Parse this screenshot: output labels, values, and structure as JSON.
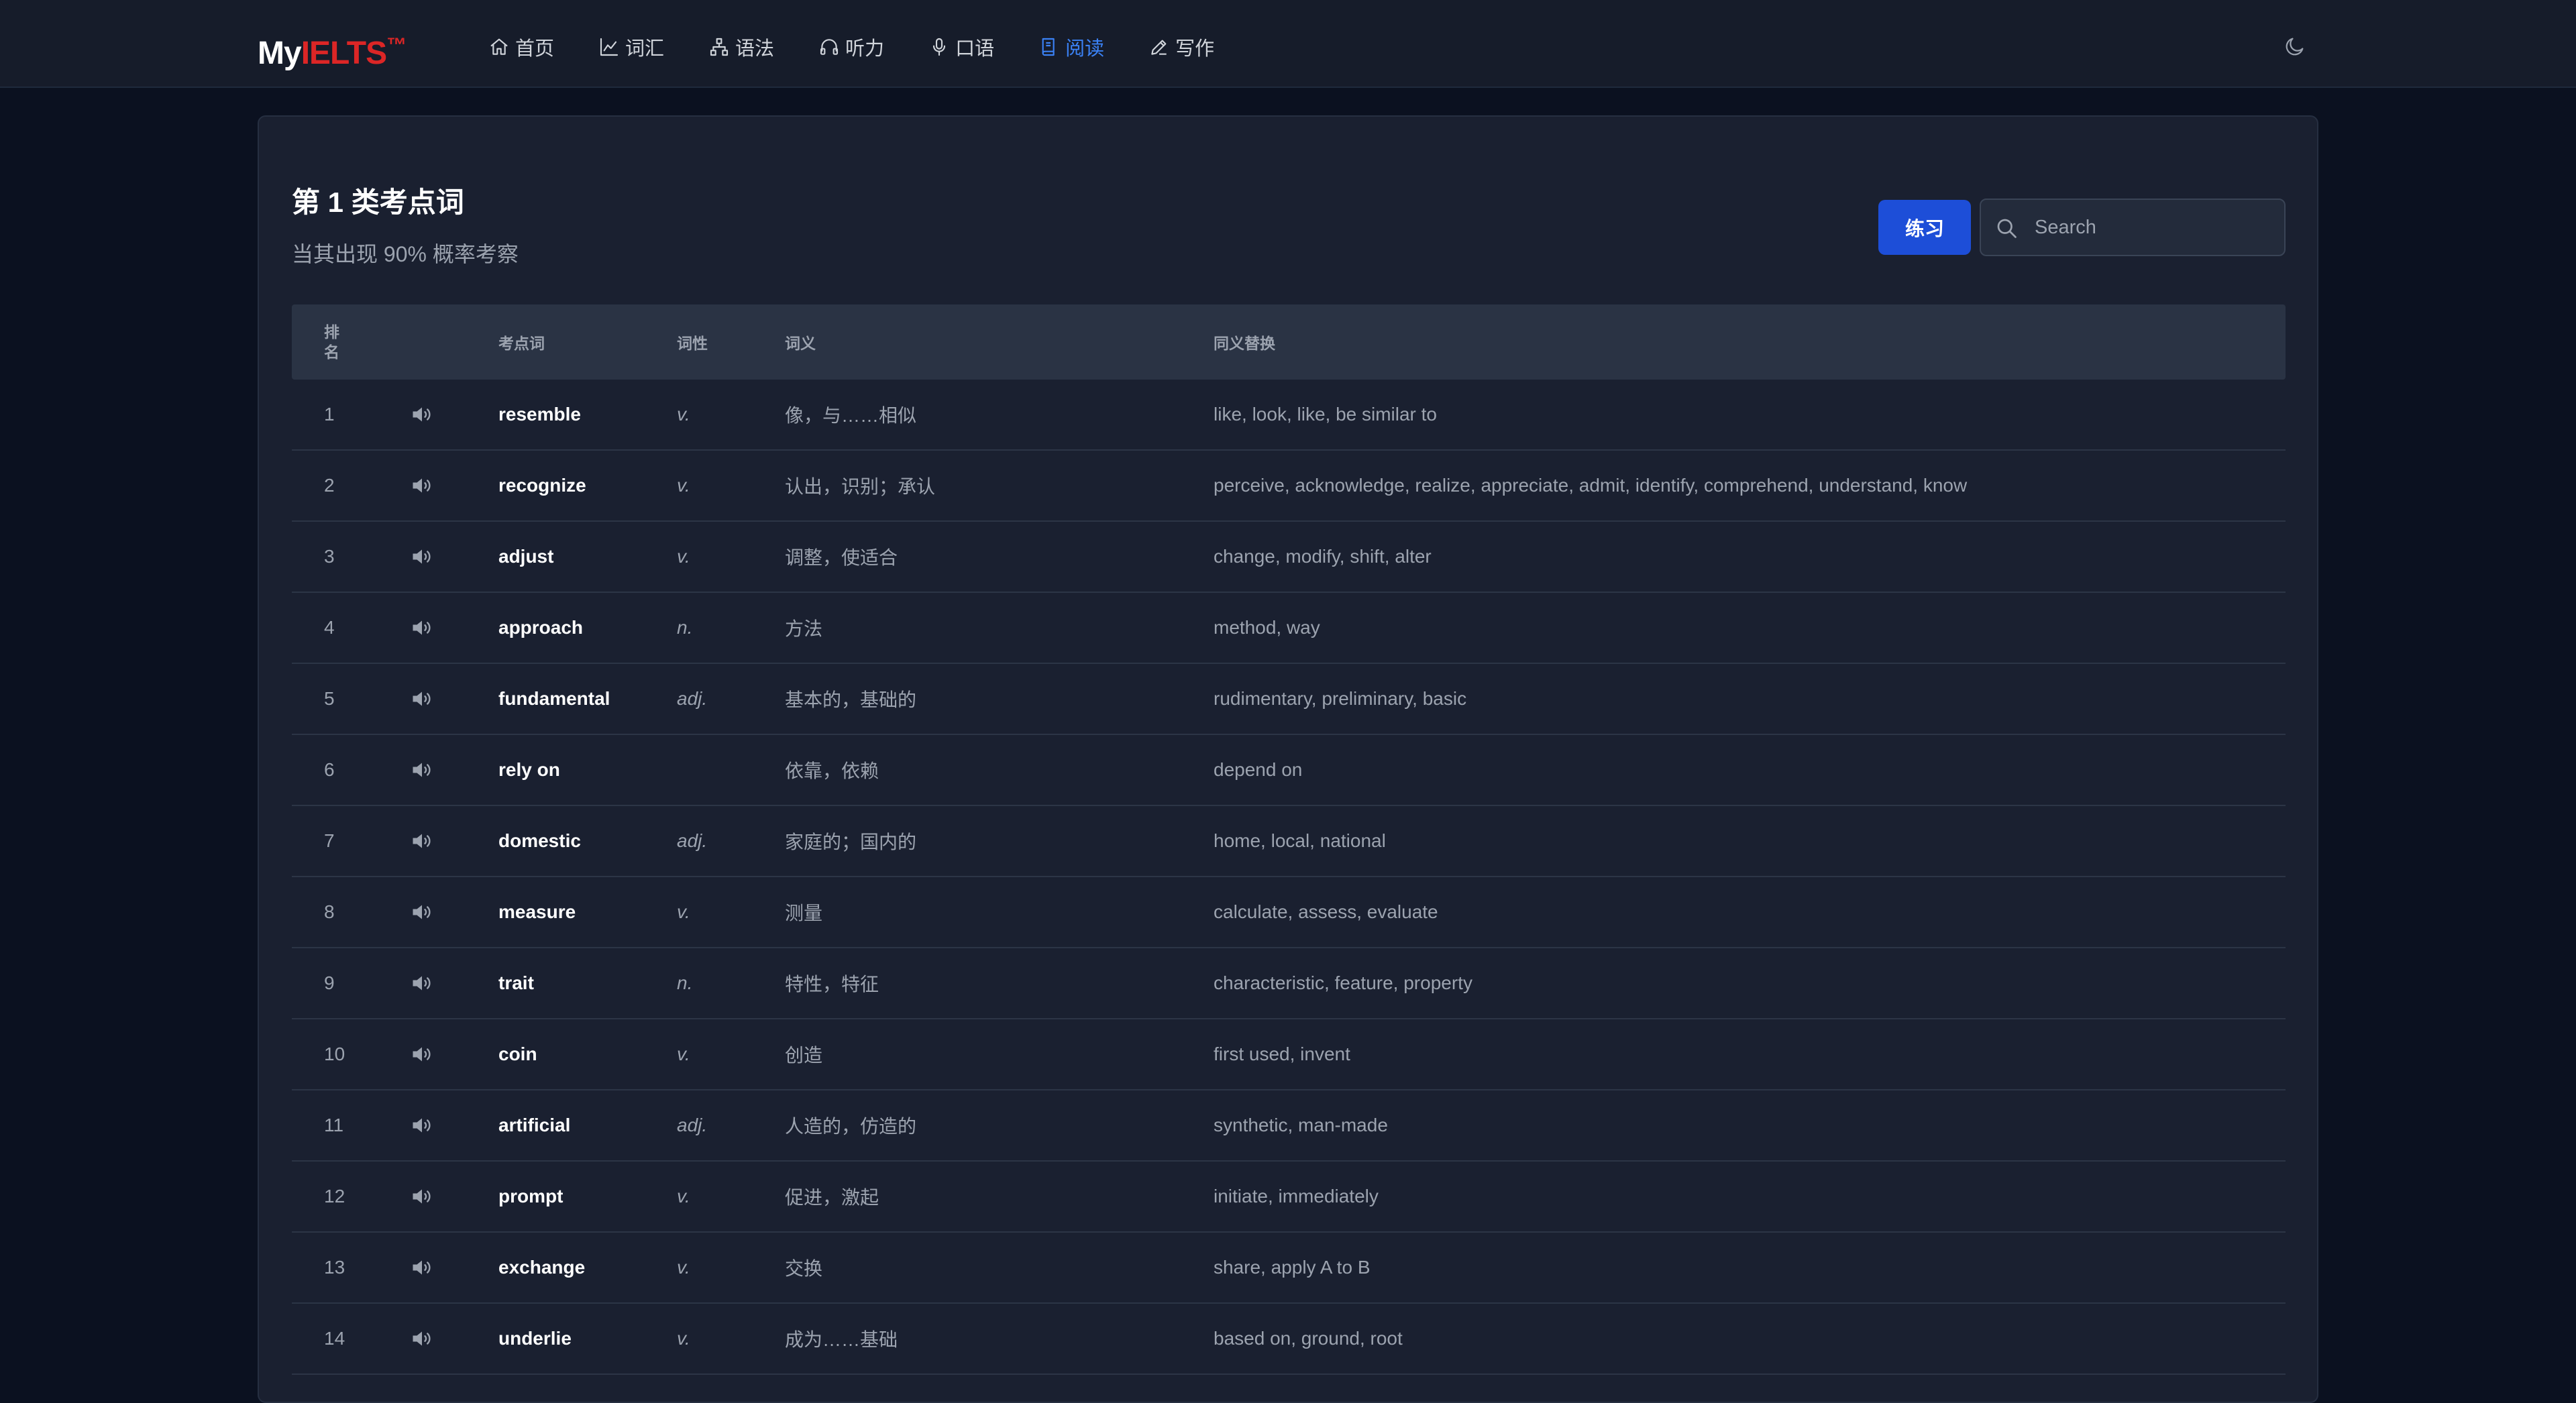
{
  "nav": {
    "logo_prefix": "My",
    "logo_brand": "IELTS",
    "logo_tm": "™",
    "items": [
      {
        "label": "首页",
        "icon": "home-icon",
        "active": false
      },
      {
        "label": "词汇",
        "icon": "chart-icon",
        "active": false
      },
      {
        "label": "语法",
        "icon": "sitemap-icon",
        "active": false
      },
      {
        "label": "听力",
        "icon": "headphones-icon",
        "active": false
      },
      {
        "label": "口语",
        "icon": "microphone-icon",
        "active": false
      },
      {
        "label": "阅读",
        "icon": "book-icon",
        "active": true
      },
      {
        "label": "写作",
        "icon": "pencil-icon",
        "active": false
      }
    ],
    "theme_icon": "moon-icon"
  },
  "card": {
    "title": "第 1 类考点词",
    "subtitle": "当其出现 90% 概率考察",
    "practice_label": "练习",
    "search_placeholder": "Search"
  },
  "table": {
    "headers": {
      "rank": "排名",
      "word": "考点词",
      "pos": "词性",
      "meaning": "词义",
      "synonyms": "同义替换"
    },
    "rows": [
      {
        "rank": "1",
        "word": "resemble",
        "pos": "v.",
        "meaning": "像，与……相似",
        "synonyms": "like, look, like, be similar to"
      },
      {
        "rank": "2",
        "word": "recognize",
        "pos": "v.",
        "meaning": "认出，识别；承认",
        "synonyms": "perceive, acknowledge, realize, appreciate, admit, identify, comprehend, understand, know"
      },
      {
        "rank": "3",
        "word": "adjust",
        "pos": "v.",
        "meaning": "调整，使适合",
        "synonyms": "change, modify, shift, alter"
      },
      {
        "rank": "4",
        "word": "approach",
        "pos": "n.",
        "meaning": "方法",
        "synonyms": "method, way"
      },
      {
        "rank": "5",
        "word": "fundamental",
        "pos": "adj.",
        "meaning": "基本的，基础的",
        "synonyms": "rudimentary, preliminary, basic"
      },
      {
        "rank": "6",
        "word": "rely on",
        "pos": "",
        "meaning": "依靠，依赖",
        "synonyms": "depend on"
      },
      {
        "rank": "7",
        "word": "domestic",
        "pos": "adj.",
        "meaning": "家庭的；国内的",
        "synonyms": "home, local, national"
      },
      {
        "rank": "8",
        "word": "measure",
        "pos": "v.",
        "meaning": "测量",
        "synonyms": "calculate, assess, evaluate"
      },
      {
        "rank": "9",
        "word": "trait",
        "pos": "n.",
        "meaning": "特性，特征",
        "synonyms": "characteristic, feature, property"
      },
      {
        "rank": "10",
        "word": "coin",
        "pos": "v.",
        "meaning": "创造",
        "synonyms": "first used, invent"
      },
      {
        "rank": "11",
        "word": "artificial",
        "pos": "adj.",
        "meaning": "人造的，仿造的",
        "synonyms": "synthetic, man-made"
      },
      {
        "rank": "12",
        "word": "prompt",
        "pos": "v.",
        "meaning": "促进，激起",
        "synonyms": "initiate, immediately"
      },
      {
        "rank": "13",
        "word": "exchange",
        "pos": "v.",
        "meaning": "交换",
        "synonyms": "share, apply A to B"
      },
      {
        "rank": "14",
        "word": "underlie",
        "pos": "v.",
        "meaning": "成为……基础",
        "synonyms": "based on, ground, root"
      }
    ]
  },
  "colors": {
    "accent": "#3b82f6",
    "brand_red": "#dc2626",
    "button_blue": "#1d4ed8"
  }
}
